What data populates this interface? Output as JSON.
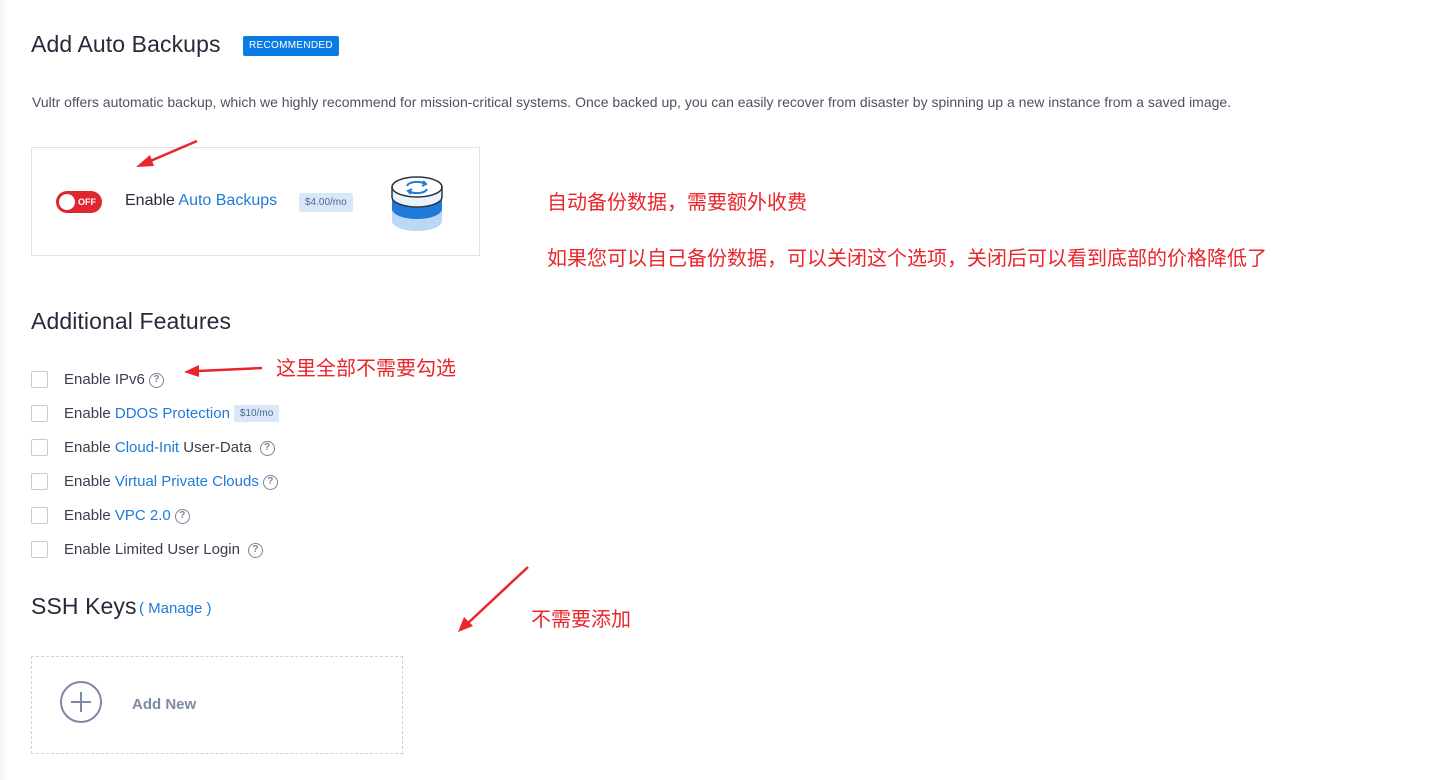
{
  "auto_backups": {
    "title": "Add Auto Backups",
    "badge": "RECOMMENDED",
    "description": "Vultr offers automatic backup, which we highly recommend for mission-critical systems. Once backed up, you can easily recover from disaster by spinning up a new instance from a saved image.",
    "toggle_state": "OFF",
    "enable_prefix": "Enable ",
    "enable_link": "Auto Backups",
    "price": "$4.00/mo"
  },
  "additional_features": {
    "title": "Additional Features",
    "items": [
      {
        "prefix": "Enable ",
        "link": "",
        "suffix": "IPv6",
        "help": true,
        "price": ""
      },
      {
        "prefix": "Enable ",
        "link": "DDOS Protection",
        "suffix": "",
        "help": false,
        "price": "$10/mo"
      },
      {
        "prefix": "Enable ",
        "link": "Cloud-Init",
        "suffix": " User-Data",
        "help": true,
        "price": ""
      },
      {
        "prefix": "Enable ",
        "link": "Virtual Private Clouds",
        "suffix": "",
        "help": true,
        "price": ""
      },
      {
        "prefix": "Enable ",
        "link": "VPC 2.0",
        "suffix": "",
        "help": true,
        "price": ""
      },
      {
        "prefix": "Enable ",
        "link": "",
        "suffix": "Limited User Login",
        "help": true,
        "price": ""
      }
    ]
  },
  "ssh_keys": {
    "title": "SSH Keys",
    "manage_label": "( Manage )",
    "add_new_label": "Add New"
  },
  "annotations": {
    "backup_note_1": "自动备份数据，需要额外收费",
    "backup_note_2": "如果您可以自己备份数据，可以关闭这个选项，关闭后可以看到底部的价格降低了",
    "features_note": "这里全部不需要勾选",
    "ssh_note": "不需要添加"
  },
  "colors": {
    "accent_blue": "#1e7bd8",
    "badge_blue": "#0b7ce6",
    "toggle_red": "#e0262e",
    "annotation_red": "#e8262c"
  },
  "icons": {
    "database": "database-sync-icon",
    "help": "help-circle-icon",
    "plus": "plus-circle-icon"
  }
}
